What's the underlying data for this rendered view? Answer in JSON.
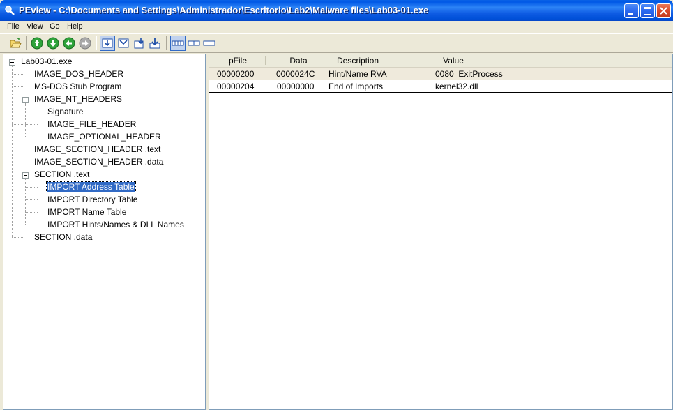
{
  "window": {
    "title": "PEview - C:\\Documents and Settings\\Administrador\\Escritorio\\Lab2\\Malware files\\Lab03-01.exe",
    "app_icon": "magnifier-icon"
  },
  "menu": [
    "File",
    "View",
    "Go",
    "Help"
  ],
  "toolbar": {
    "icons": [
      "open-folder-icon",
      "up-arrow-icon",
      "down-arrow-icon",
      "back-arrow-icon",
      "forward-arrow-icon",
      "view-hex-icon",
      "view-dropdown-icon",
      "view-dropdown-alt-icon",
      "view-download-icon",
      "byte-view-icon",
      "word-view-icon",
      "dword-view-icon"
    ]
  },
  "tree": {
    "root": "Lab03-01.exe",
    "items": [
      {
        "label": "IMAGE_DOS_HEADER"
      },
      {
        "label": "MS-DOS Stub Program"
      },
      {
        "label": "IMAGE_NT_HEADERS"
      },
      {
        "label": "Signature"
      },
      {
        "label": "IMAGE_FILE_HEADER"
      },
      {
        "label": "IMAGE_OPTIONAL_HEADER"
      },
      {
        "label": "IMAGE_SECTION_HEADER .text"
      },
      {
        "label": "IMAGE_SECTION_HEADER .data"
      },
      {
        "label": "SECTION .text"
      },
      {
        "label": "IMPORT Address Table"
      },
      {
        "label": "IMPORT Directory Table"
      },
      {
        "label": "IMPORT Name Table"
      },
      {
        "label": "IMPORT Hints/Names & DLL Names"
      },
      {
        "label": "SECTION .data"
      }
    ],
    "selected": "IMPORT Address Table"
  },
  "table": {
    "columns": [
      "pFile",
      "Data",
      "Description",
      "Value"
    ],
    "rows": [
      {
        "pfile": "00000200",
        "data": "0000024C",
        "description": "Hint/Name RVA",
        "value": "0080  ExitProcess"
      },
      {
        "pfile": "00000204",
        "data": "00000000",
        "description": "End of Imports",
        "value": "kernel32.dll"
      }
    ]
  }
}
